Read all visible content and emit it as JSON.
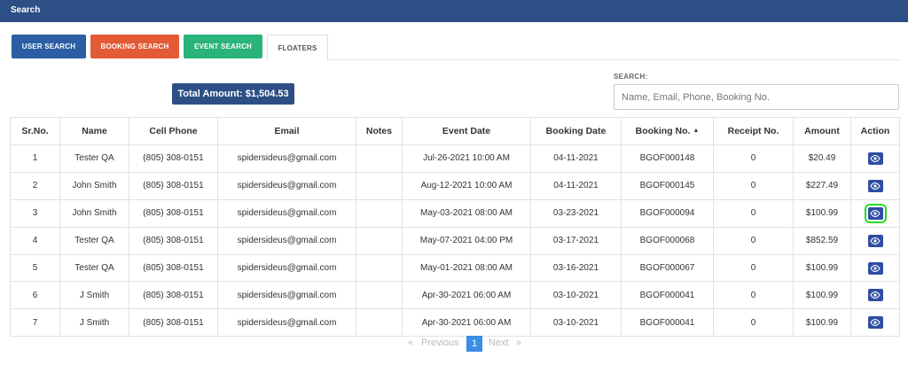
{
  "header": {
    "title": "Search"
  },
  "tabs": [
    {
      "label": "USER SEARCH"
    },
    {
      "label": "BOOKING SEARCH"
    },
    {
      "label": "EVENT SEARCH"
    },
    {
      "label": "FLOATERS"
    }
  ],
  "total_amount": "Total Amount: $1,504.53",
  "search": {
    "label": "SEARCH:",
    "placeholder": "Name, Email, Phone, Booking No.",
    "value": ""
  },
  "table": {
    "columns": [
      "Sr.No.",
      "Name",
      "Cell Phone",
      "Email",
      "Notes",
      "Event Date",
      "Booking Date",
      "Booking No.",
      "Receipt No.",
      "Amount",
      "Action"
    ],
    "sorted_column": "Booking No.",
    "sort_direction": "ascending",
    "rows": [
      {
        "sr": "1",
        "name": "Tester QA",
        "phone": "(805) 308-0151",
        "email": "spidersideus@gmail.com",
        "notes": "",
        "event_date": "Jul-26-2021 10:00 AM",
        "booking_date": "04-11-2021",
        "booking_no": "BGOF000148",
        "receipt_no": "0",
        "amount": "$20.49"
      },
      {
        "sr": "2",
        "name": "John Smith",
        "phone": "(805) 308-0151",
        "email": "spidersideus@gmail.com",
        "notes": "",
        "event_date": "Aug-12-2021 10:00 AM",
        "booking_date": "04-11-2021",
        "booking_no": "BGOF000145",
        "receipt_no": "0",
        "amount": "$227.49"
      },
      {
        "sr": "3",
        "name": "John Smith",
        "phone": "(805) 308-0151",
        "email": "spidersideus@gmail.com",
        "notes": "",
        "event_date": "May-03-2021 08:00 AM",
        "booking_date": "03-23-2021",
        "booking_no": "BGOF000094",
        "receipt_no": "0",
        "amount": "$100.99"
      },
      {
        "sr": "4",
        "name": "Tester QA",
        "phone": "(805) 308-0151",
        "email": "spidersideus@gmail.com",
        "notes": "",
        "event_date": "May-07-2021 04:00 PM",
        "booking_date": "03-17-2021",
        "booking_no": "BGOF000068",
        "receipt_no": "0",
        "amount": "$852.59"
      },
      {
        "sr": "5",
        "name": "Tester QA",
        "phone": "(805) 308-0151",
        "email": "spidersideus@gmail.com",
        "notes": "",
        "event_date": "May-01-2021 08:00 AM",
        "booking_date": "03-16-2021",
        "booking_no": "BGOF000067",
        "receipt_no": "0",
        "amount": "$100.99"
      },
      {
        "sr": "6",
        "name": "J Smith",
        "phone": "(805) 308-0151",
        "email": "spidersideus@gmail.com",
        "notes": "",
        "event_date": "Apr-30-2021 06:00 AM",
        "booking_date": "03-10-2021",
        "booking_no": "BGOF000041",
        "receipt_no": "0",
        "amount": "$100.99"
      },
      {
        "sr": "7",
        "name": "J Smith",
        "phone": "(805) 308-0151",
        "email": "spidersideus@gmail.com",
        "notes": "",
        "event_date": "Apr-30-2021 06:00 AM",
        "booking_date": "03-10-2021",
        "booking_no": "BGOF000041",
        "receipt_no": "0",
        "amount": "$100.99"
      }
    ],
    "action_icon": "eye-icon",
    "highlighted_row": 3
  },
  "pagination": {
    "prev_arrow": "«",
    "prev_label": "Previous",
    "current_page": "1",
    "next_label": "Next",
    "next_arrow": "»"
  },
  "colors": {
    "header": "#2c4f86",
    "user_tab": "#2b5ea4",
    "booking_tab": "#e25a36",
    "event_tab": "#2ab37a",
    "action_button": "#2f4ea3",
    "highlight": "#22dd22",
    "current_page": "#3a8ee6"
  }
}
